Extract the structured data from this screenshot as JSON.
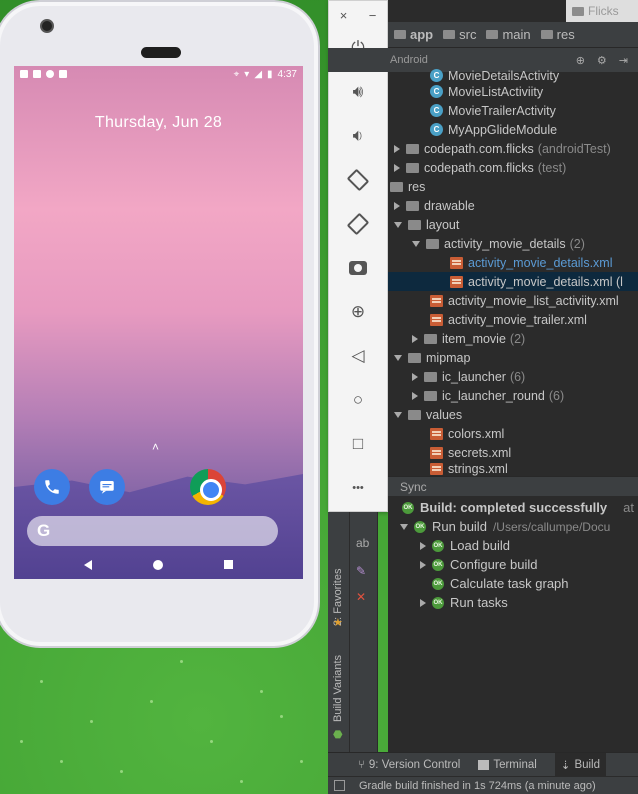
{
  "phone": {
    "time": "4:37",
    "date": "Thursday, Jun 28",
    "google_g": "G"
  },
  "emulator": {
    "close": "×",
    "minimize": "−",
    "more": "•••"
  },
  "ide": {
    "tab_title": "Flicks",
    "breadcrumbs": [
      "app",
      "src",
      "main",
      "res"
    ],
    "view_mode": "Android",
    "tree": [
      {
        "label": "MovieDetailsActivity",
        "kind": "class",
        "indent": 1
      },
      {
        "label": "MovieListActiviity",
        "kind": "class",
        "indent": 1
      },
      {
        "label": "MovieTrailerActivity",
        "kind": "class",
        "indent": 1
      },
      {
        "label": "MyAppGlideModule",
        "kind": "class",
        "indent": 1
      },
      {
        "label": "codepath.com.flicks",
        "muted": "(androidTest)",
        "kind": "package"
      },
      {
        "label": "codepath.com.flicks",
        "muted": "(test)",
        "kind": "package"
      },
      {
        "label": "res",
        "kind": "folder"
      },
      {
        "label": "drawable",
        "kind": "folder"
      },
      {
        "label": "layout",
        "kind": "folder"
      },
      {
        "label": "activity_movie_details",
        "muted": "(2)",
        "kind": "folder"
      },
      {
        "label": "activity_movie_details.xml",
        "kind": "xml"
      },
      {
        "label": "activity_movie_details.xml (l",
        "kind": "xml"
      },
      {
        "label": "activity_movie_list_activiity.xml",
        "kind": "xml"
      },
      {
        "label": "activity_movie_trailer.xml",
        "kind": "xml"
      },
      {
        "label": "item_movie",
        "muted": "(2)",
        "kind": "folder"
      },
      {
        "label": "mipmap",
        "kind": "folder"
      },
      {
        "label": "ic_launcher",
        "muted": "(6)",
        "kind": "folder"
      },
      {
        "label": "ic_launcher_round",
        "muted": "(6)",
        "kind": "folder"
      },
      {
        "label": "values",
        "kind": "folder"
      },
      {
        "label": "colors.xml",
        "kind": "xml"
      },
      {
        "label": "secrets.xml",
        "kind": "xml"
      },
      {
        "label": "strings.xml",
        "kind": "xml"
      }
    ],
    "build_panel": {
      "sync_tab": "Sync",
      "status_line": "Build: completed successfully",
      "status_suffix": "at",
      "run_build": "Run build",
      "run_build_path": "/Users/callumpe/Docu",
      "load_build": "Load build",
      "configure_build": "Configure build",
      "calculate_task_graph": "Calculate task graph",
      "run_tasks": "Run tasks",
      "ok_badge": "OK"
    },
    "side_tabs": {
      "favorites": "2: Favorites",
      "build_variants": "Build Variants"
    },
    "bottom_tabs": {
      "version_control": "9: Version Control",
      "terminal": "Terminal",
      "build": "Build"
    },
    "status_bar": "Gradle build finished in 1s 724ms (a minute ago)"
  }
}
